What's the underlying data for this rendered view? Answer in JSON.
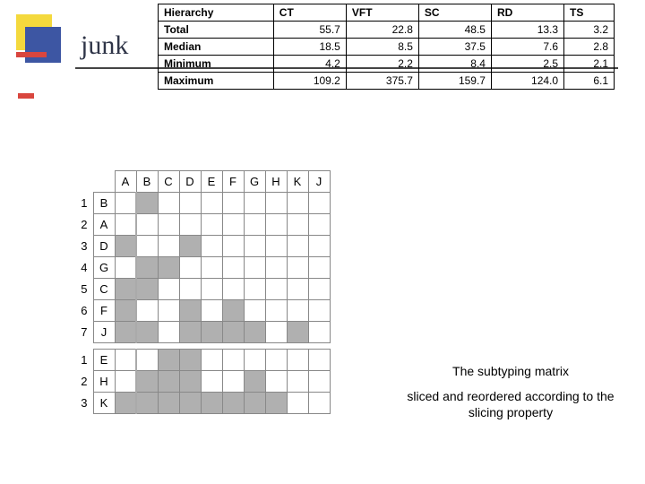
{
  "title": "junk",
  "hierarchy": {
    "header": {
      "label": "Hierarchy",
      "cols": [
        "CT",
        "VFT",
        "SC",
        "RD",
        "TS"
      ]
    },
    "rows": [
      {
        "label": "Total",
        "vals": [
          "55.7",
          "22.8",
          "48.5",
          "13.3",
          "3.2"
        ]
      },
      {
        "label": "Median",
        "vals": [
          "18.5",
          "8.5",
          "37.5",
          "7.6",
          "2.8"
        ]
      },
      {
        "label": "Minimum",
        "vals": [
          "4.2",
          "2.2",
          "8.4",
          "2.5",
          "2.1"
        ]
      },
      {
        "label": "Maximum",
        "vals": [
          "109.2",
          "375.7",
          "159.7",
          "124.0",
          "6.1"
        ]
      }
    ]
  },
  "grid": {
    "cols": [
      "A",
      "B",
      "C",
      "D",
      "E",
      "F",
      "G",
      "H",
      "K",
      "J"
    ],
    "block1": [
      {
        "num": "1",
        "head": "B",
        "fill": [
          1
        ]
      },
      {
        "num": "2",
        "head": "A",
        "fill": []
      },
      {
        "num": "3",
        "head": "D",
        "fill": [
          0,
          3
        ]
      },
      {
        "num": "4",
        "head": "G",
        "fill": [
          1,
          2
        ]
      },
      {
        "num": "5",
        "head": "C",
        "fill": [
          0,
          1
        ]
      },
      {
        "num": "6",
        "head": "F",
        "fill": [
          0,
          3,
          5
        ]
      },
      {
        "num": "7",
        "head": "J",
        "fill": [
          0,
          1,
          3,
          4,
          5,
          6,
          8
        ]
      }
    ],
    "block2": [
      {
        "num": "1",
        "head": "E",
        "fill": [
          2,
          3
        ]
      },
      {
        "num": "2",
        "head": "H",
        "fill": [
          1,
          2,
          3,
          6
        ]
      },
      {
        "num": "3",
        "head": "K",
        "fill": [
          0,
          1,
          2,
          3,
          4,
          5,
          6,
          7
        ]
      }
    ]
  },
  "caption": {
    "line1": "The subtyping matrix",
    "line2": "sliced and reordered according to the slicing property"
  }
}
